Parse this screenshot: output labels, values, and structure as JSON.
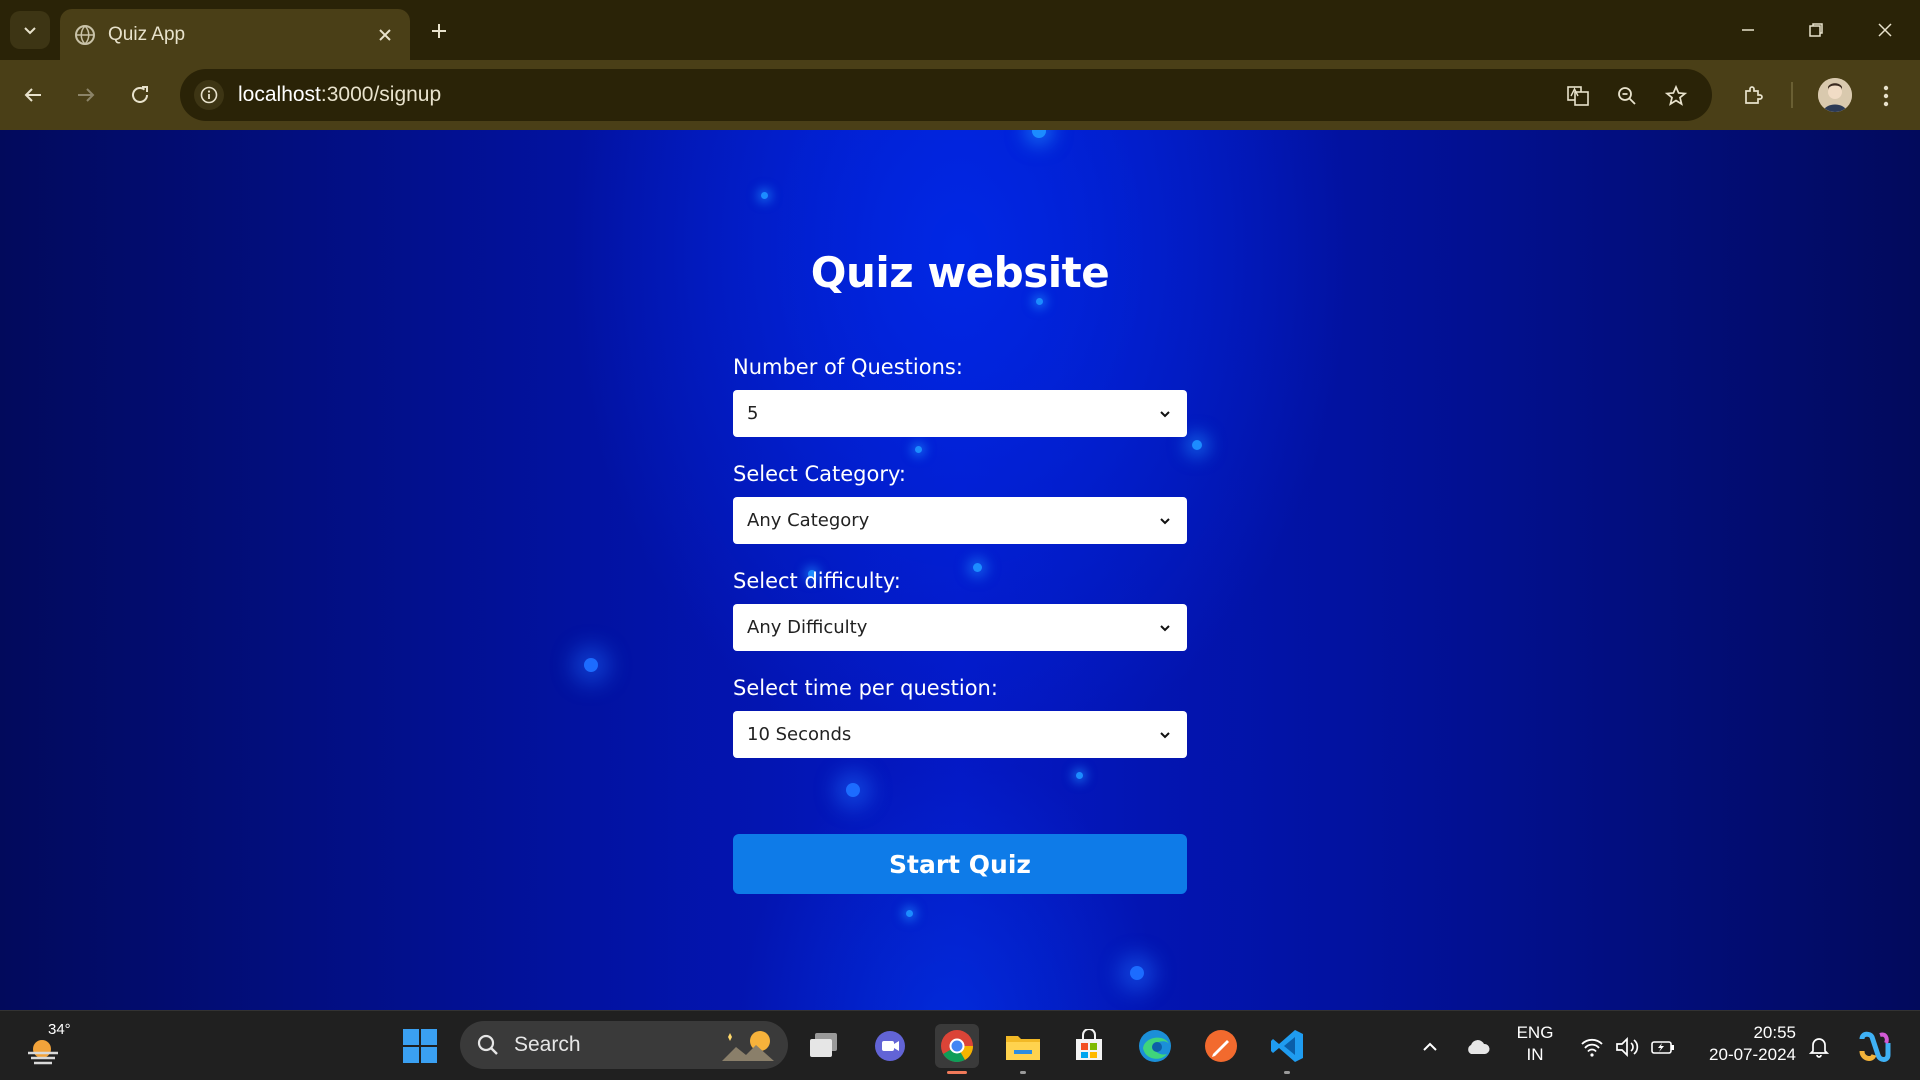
{
  "browser": {
    "tab_title": "Quiz App",
    "url_host": "localhost",
    "url_path": ":3000/signup"
  },
  "page": {
    "heading": "Quiz website",
    "fields": [
      {
        "label": "Number of Questions:",
        "value": "5"
      },
      {
        "label": "Select Category:",
        "value": "Any Category"
      },
      {
        "label": "Select difficulty:",
        "value": "Any Difficulty"
      },
      {
        "label": "Select time per question:",
        "value": "10 Seconds"
      }
    ],
    "start_button": "Start Quiz"
  },
  "taskbar": {
    "weather_temp": "34°",
    "search_label": "Search",
    "lang_line1": "ENG",
    "lang_line2": "IN",
    "time": "20:55",
    "date": "20-07-2024"
  },
  "colors": {
    "accent_button": "#0e7be8",
    "page_bg": "#0418c4",
    "chrome_bg": "#4a3f17"
  },
  "icons": [
    "tab-search-icon",
    "globe-icon",
    "close-icon",
    "plus-icon",
    "minimize-icon",
    "restore-icon",
    "back-arrow-icon",
    "forward-arrow-icon",
    "reload-icon",
    "info-icon",
    "translate-icon",
    "zoom-icon",
    "star-icon",
    "extensions-icon",
    "kebab-menu-icon",
    "chevron-down-icon",
    "windows-start-icon",
    "search-icon",
    "chrome-icon",
    "file-explorer-icon",
    "store-icon",
    "edge-icon",
    "vscode-icon",
    "wifi-icon",
    "volume-icon",
    "battery-icon",
    "bell-icon",
    "copilot-icon"
  ]
}
